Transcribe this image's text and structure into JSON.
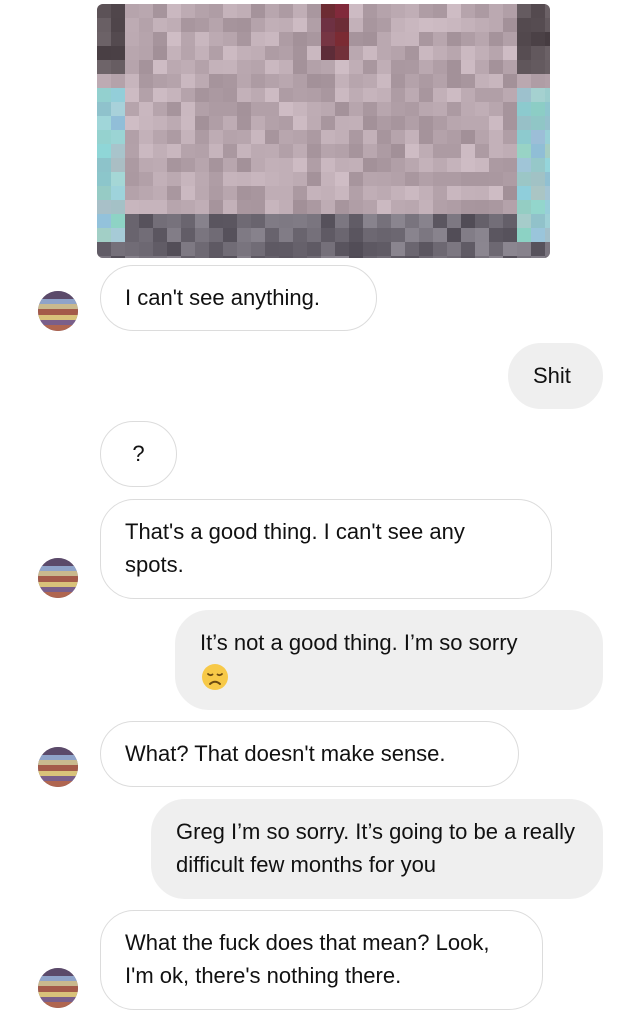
{
  "chat": {
    "messages": [
      {
        "from": "them",
        "text": "I can't see anything."
      },
      {
        "from": "me",
        "text": "Shit"
      },
      {
        "from": "them",
        "text": "?"
      },
      {
        "from": "them",
        "text": "That's a good thing. I can't see any spots."
      },
      {
        "from": "me",
        "text": "It’s not a good thing. I’m so sorry",
        "emoji": "disappointed-face"
      },
      {
        "from": "them",
        "text": "What? That doesn't make sense."
      },
      {
        "from": "me",
        "text": "Greg I’m so sorry. It’s going to be a really difficult few months for you"
      },
      {
        "from": "them",
        "text": "What the fuck does that mean? Look, I'm ok, there's nothing there."
      }
    ]
  },
  "colors": {
    "incoming_bubble": "#ffffff",
    "incoming_border": "#dcdcdc",
    "outgoing_bubble": "#efefef",
    "text": "#111111"
  }
}
